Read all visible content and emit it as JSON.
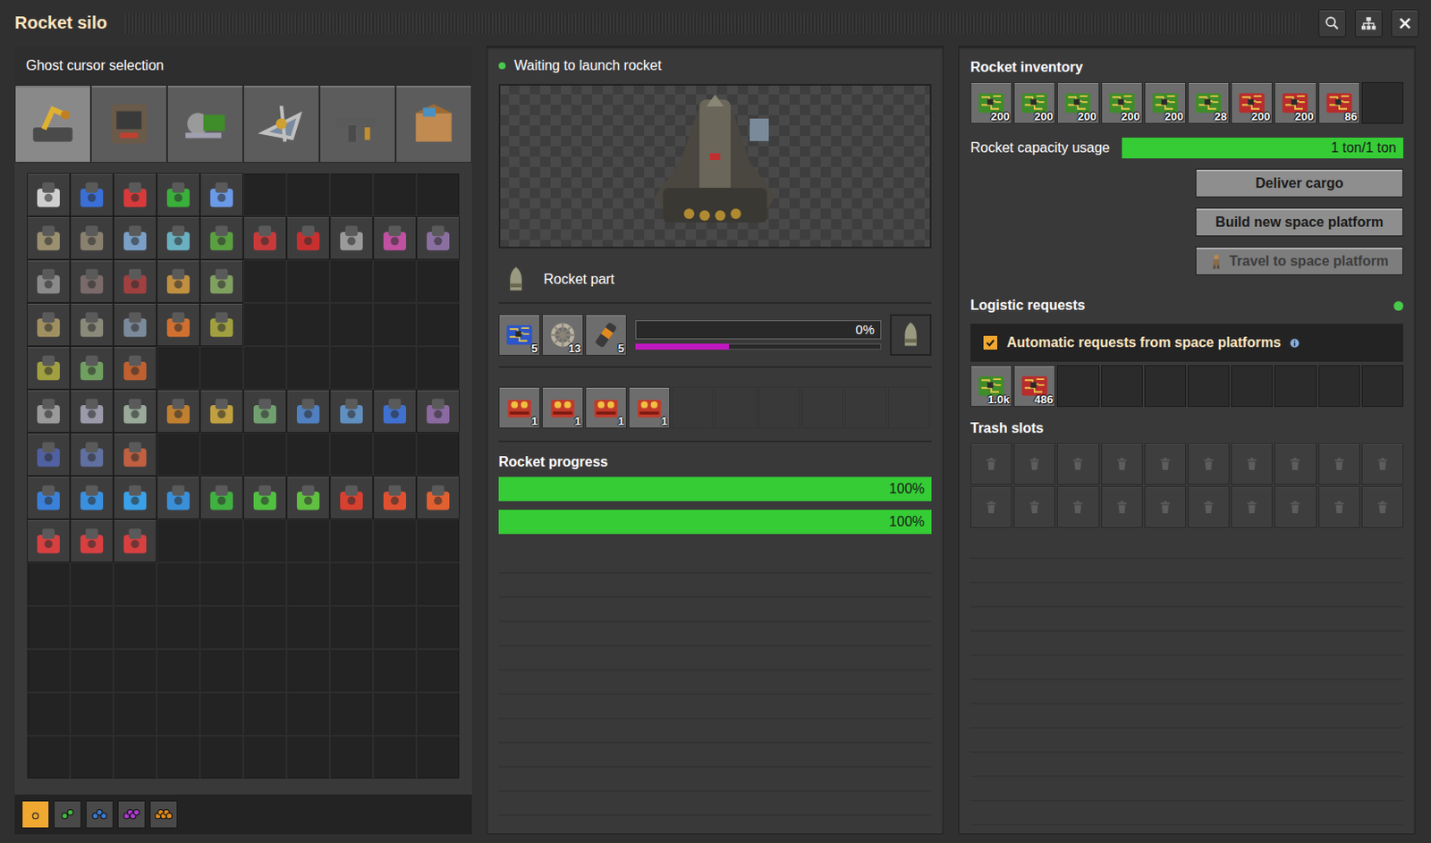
{
  "window": {
    "title": "Rocket silo"
  },
  "ghost_selection": {
    "title": "Ghost cursor selection",
    "tabs": [
      {
        "selected": true
      },
      {
        "selected": false
      },
      {
        "selected": false
      },
      {
        "selected": false
      },
      {
        "selected": false
      },
      {
        "selected": false
      }
    ],
    "grid_rows": [
      5,
      10,
      5,
      5,
      3,
      10,
      3,
      10,
      3,
      0,
      0,
      0,
      0,
      0
    ],
    "quality": [
      {
        "selected": true,
        "color": "#9a9a9a"
      },
      {
        "selected": false,
        "color": "#3fbf3f"
      },
      {
        "selected": false,
        "color": "#3a7bd5"
      },
      {
        "selected": false,
        "color": "#b03ad5"
      },
      {
        "selected": false,
        "color": "#e38a1a"
      }
    ]
  },
  "silo": {
    "status": "Waiting to launch rocket",
    "ok": true,
    "recipe": "Rocket part",
    "ingredients": [
      {
        "kind": "blue-circuit",
        "count": "5"
      },
      {
        "kind": "structure",
        "count": "13"
      },
      {
        "kind": "fuel",
        "count": "5"
      }
    ],
    "crafting": {
      "reading": "0%",
      "level": 0,
      "sub_level": 0.38
    },
    "modules": [
      {
        "kind": "module",
        "count": "1"
      },
      {
        "kind": "module",
        "count": "1"
      },
      {
        "kind": "module",
        "count": "1"
      },
      {
        "kind": "module",
        "count": "1"
      },
      {
        "kind": "empty",
        "count": ""
      },
      {
        "kind": "empty",
        "count": ""
      },
      {
        "kind": "empty",
        "count": ""
      },
      {
        "kind": "empty",
        "count": ""
      },
      {
        "kind": "empty",
        "count": ""
      },
      {
        "kind": "empty",
        "count": ""
      }
    ],
    "progress_title": "Rocket progress",
    "progress": [
      {
        "reading": "100%",
        "level": 1
      },
      {
        "reading": "100%",
        "level": 1
      }
    ]
  },
  "rocket": {
    "title": "Rocket inventory",
    "slots": [
      {
        "kind": "green-circuit",
        "count": "200"
      },
      {
        "kind": "green-circuit",
        "count": "200"
      },
      {
        "kind": "green-circuit",
        "count": "200"
      },
      {
        "kind": "green-circuit",
        "count": "200"
      },
      {
        "kind": "green-circuit",
        "count": "200"
      },
      {
        "kind": "green-circuit",
        "count": "28"
      },
      {
        "kind": "red-circuit",
        "count": "200"
      },
      {
        "kind": "red-circuit",
        "count": "200"
      },
      {
        "kind": "red-circuit",
        "count": "86"
      },
      {
        "kind": "empty",
        "count": ""
      }
    ],
    "capacity": {
      "label": "Rocket capacity usage",
      "reading": "1 ton/1 ton",
      "level": 1
    },
    "buttons": [
      {
        "label": "Deliver cargo",
        "disabled": false
      },
      {
        "label": "Build new space platform",
        "disabled": false
      },
      {
        "label": "Travel to space platform",
        "disabled": true
      }
    ]
  },
  "logistics": {
    "title": "Logistic requests",
    "active": true,
    "auto": {
      "label": "Automatic requests from space platforms",
      "checked": true
    },
    "requests": [
      {
        "kind": "green-circuit",
        "count": "1.0k"
      },
      {
        "kind": "red-circuit",
        "count": "486"
      },
      {
        "kind": "empty",
        "count": ""
      },
      {
        "kind": "empty",
        "count": ""
      },
      {
        "kind": "empty",
        "count": ""
      },
      {
        "kind": "empty",
        "count": ""
      },
      {
        "kind": "empty",
        "count": ""
      },
      {
        "kind": "empty",
        "count": ""
      },
      {
        "kind": "empty",
        "count": ""
      },
      {
        "kind": "empty",
        "count": ""
      }
    ]
  },
  "trash": {
    "title": "Trash slots",
    "slots": 20
  }
}
